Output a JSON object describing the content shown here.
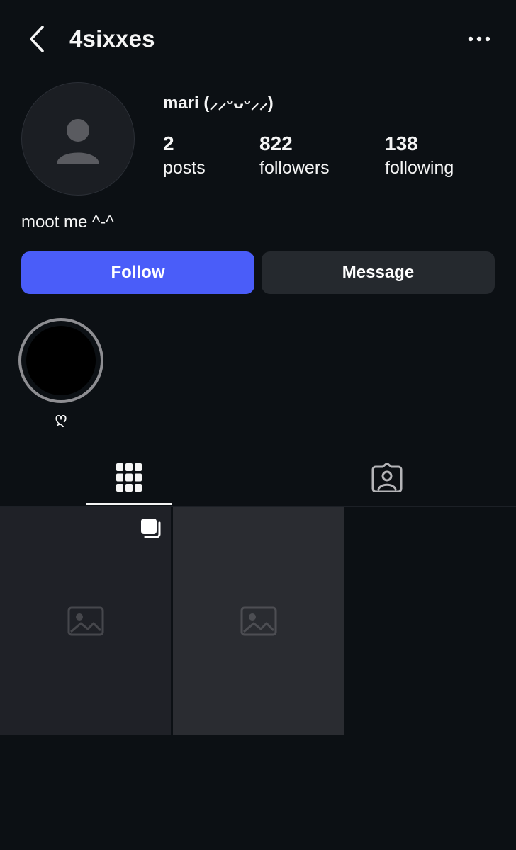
{
  "header": {
    "username": "4sixxes",
    "back_icon": "chevron-left-icon",
    "more_icon": "ellipsis-icon"
  },
  "profile": {
    "display_name": "mari (⸝⸝ᵕᴗᵕ⸝⸝)",
    "bio": "moot me ^-^",
    "stats": [
      {
        "value": "2",
        "label": "posts"
      },
      {
        "value": "822",
        "label": "followers"
      },
      {
        "value": "138",
        "label": "following"
      }
    ]
  },
  "actions": {
    "follow_label": "Follow",
    "message_label": "Message"
  },
  "highlights": [
    {
      "label": "ღ"
    }
  ],
  "tabs": [
    {
      "icon": "grid-icon",
      "active": true
    },
    {
      "icon": "tagged-person-icon",
      "active": false
    }
  ],
  "posts": [
    {
      "type": "carousel",
      "content": "image placeholder"
    },
    {
      "type": "single",
      "content": "image placeholder"
    }
  ],
  "colors": {
    "background": "#0c1014",
    "accent": "#4a5df9",
    "secondary_button": "#25292e",
    "text": "#f5f5f5"
  }
}
